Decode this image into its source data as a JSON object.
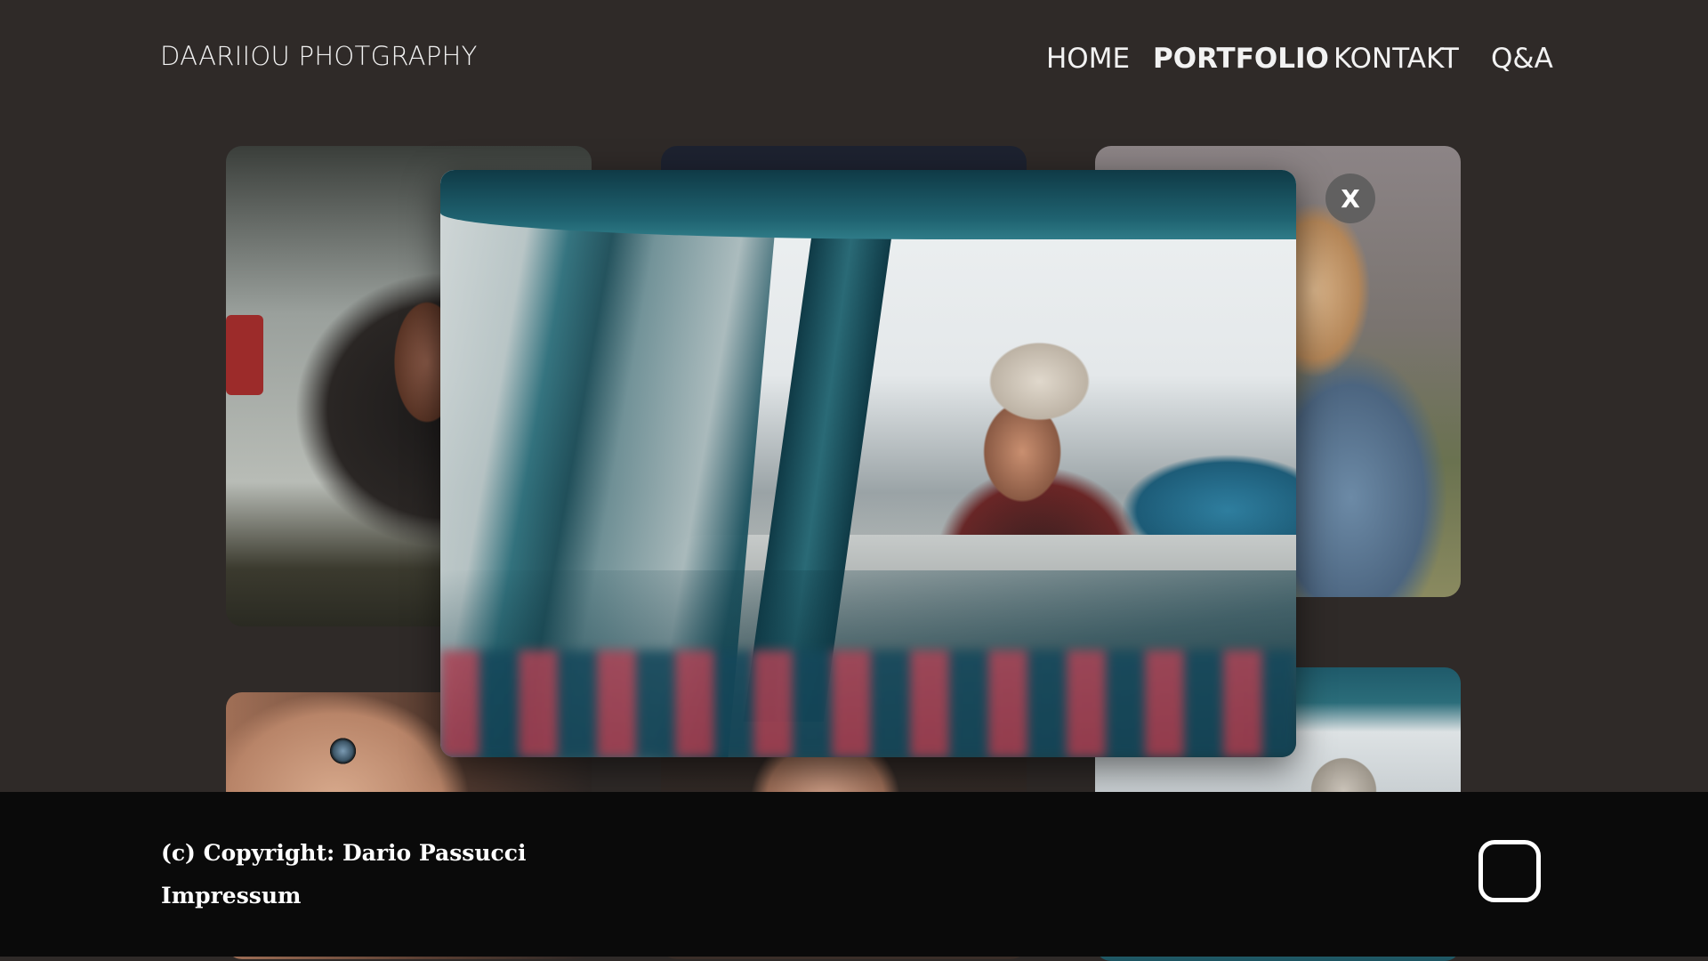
{
  "header": {
    "brand": "DAARIIOU PHOTGRAPHY",
    "nav": {
      "home": "HOME",
      "portfolio": "PORTFOLIO",
      "kontakt": "KONTAKT",
      "qa": "Q&A"
    },
    "active_nav": "PORTFOLIO"
  },
  "gallery": {
    "tiles": [
      {
        "subject": "two women sitting in car trunk"
      },
      {
        "subject": "dark portrait"
      },
      {
        "subject": "woman in denim jacket"
      },
      {
        "subject": "close-up eye portrait"
      },
      {
        "subject": "portrait"
      },
      {
        "subject": "woman in van"
      }
    ]
  },
  "lightbox": {
    "subject": "woman in beanie looking out of van window",
    "close_label": "X"
  },
  "footer": {
    "copyright": "(c) Copyright: Dario Passucci",
    "impressum": "Impressum",
    "social_icon": "instagram-icon"
  },
  "colors": {
    "background": "#2f2a28",
    "footer": "#0a0a0a",
    "text": "#ffffff"
  }
}
